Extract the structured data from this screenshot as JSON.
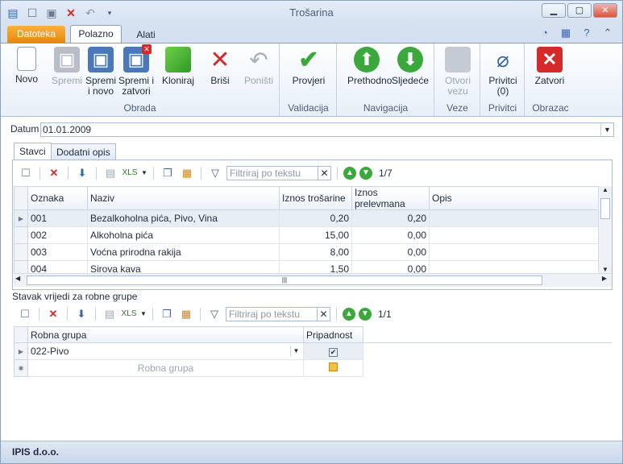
{
  "window": {
    "title": "Trošarina"
  },
  "tabs": {
    "file": "Datoteka",
    "home": "Polazno",
    "tools": "Alati"
  },
  "ribbon": {
    "groups": {
      "obrada": "Obrada",
      "validacija": "Validacija",
      "navigacija": "Navigacija",
      "veze": "Veze",
      "privitci": "Privitci",
      "obrazac": "Obrazac"
    },
    "buttons": {
      "novo": "Novo",
      "spremi": "Spremi",
      "spremi_novo_1": "Spremi",
      "spremi_novo_2": "i novo",
      "spremi_zatvori_1": "Spremi i",
      "spremi_zatvori_2": "zatvori",
      "kloniraj": "Kloniraj",
      "brisi": "Briši",
      "ponisti": "Poništi",
      "provjeri": "Provjeri",
      "prethodno": "Prethodno",
      "sljedece": "Sljedeće",
      "otvori_vezu_1": "Otvori",
      "otvori_vezu_2": "vezu",
      "privitci_1": "Privitci",
      "privitci_2": "(0)",
      "zatvori": "Zatvori"
    }
  },
  "header": {
    "datum_label": "Datum",
    "datum_value": "01.01.2009"
  },
  "inner_tabs": {
    "stavci": "Stavci",
    "dodatni_opis": "Dodatni opis"
  },
  "grid1": {
    "filter_placeholder": "Filtriraj po tekstu",
    "counter": "1/7",
    "columns": [
      "Oznaka",
      "Naziv",
      "Iznos trošarine",
      "Iznos prelevmana",
      "Opis"
    ],
    "rows": [
      [
        "001",
        "Bezalkoholna pića, Pivo, Vina",
        "0,20",
        "0,20",
        ""
      ],
      [
        "002",
        "Alkoholna pića",
        "15,00",
        "0,00",
        ""
      ],
      [
        "003",
        "Voćna prirodna rakija",
        "8,00",
        "0,00",
        ""
      ],
      [
        "004",
        "Sirova kava",
        "1,50",
        "0,00",
        ""
      ]
    ]
  },
  "section2": {
    "title": "Stavak vrijedi za robne grupe"
  },
  "grid2": {
    "filter_placeholder": "Filtriraj po tekstu",
    "counter": "1/1",
    "columns": [
      "Robna grupa",
      "Pripadnost"
    ],
    "rows": [
      [
        "022-Pivo",
        "checked"
      ]
    ],
    "new_row_placeholder": "Robna grupa"
  },
  "status": {
    "company": "IPIS d.o.o."
  },
  "colors": {
    "file_tab": "#e58a0d",
    "accent_blue": "#3a66a8",
    "green": "#3aa83a",
    "red": "#d42a2a"
  }
}
